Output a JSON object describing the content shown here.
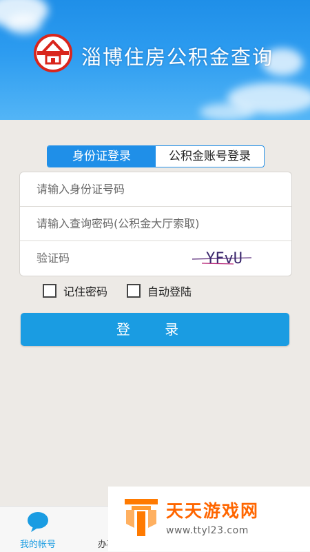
{
  "app": {
    "title": "淄博住房公积金查询"
  },
  "login_tabs": [
    {
      "label": "身份证登录",
      "active": true
    },
    {
      "label": "公积金账号登录",
      "active": false
    }
  ],
  "form": {
    "id_placeholder": "请输入身份证号码",
    "password_placeholder": "请输入查询密码(公积金大厅索取)",
    "captcha_placeholder": "验证码",
    "captcha_text": "YFvU"
  },
  "options": {
    "remember_label": "记住密码",
    "auto_login_label": "自动登陆"
  },
  "login_button": "登 录",
  "bottom_nav": {
    "my_account": "我的帐号",
    "second": "办事"
  },
  "watermark": {
    "title": "天天游戏网",
    "url": "www.ttyl23.com"
  },
  "colors": {
    "primary": "#1f8fe8",
    "button": "#1a9ce2",
    "logo_red": "#d9251c",
    "watermark_orange": "#ff6600"
  },
  "icons": [
    "house-logo-icon",
    "chat-bubble-icon",
    "watermark-logo-icon"
  ]
}
